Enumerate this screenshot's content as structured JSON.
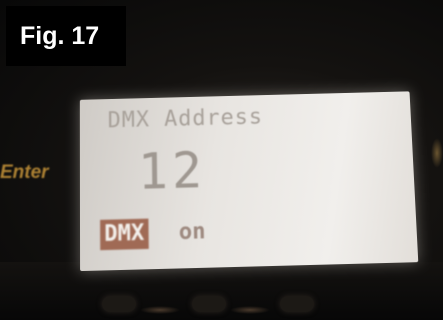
{
  "figure": {
    "label": "Fig. 17"
  },
  "device": {
    "side_button_label": "Enter"
  },
  "lcd": {
    "title": "DMX Address",
    "value": "12",
    "mode_label": "DMX",
    "state_label": "on"
  },
  "colors": {
    "lcd_background": "#ebe8e4",
    "lcd_text": "#a8a19a",
    "mode_highlight": "#a06a55",
    "button_label": "#c9963a"
  }
}
